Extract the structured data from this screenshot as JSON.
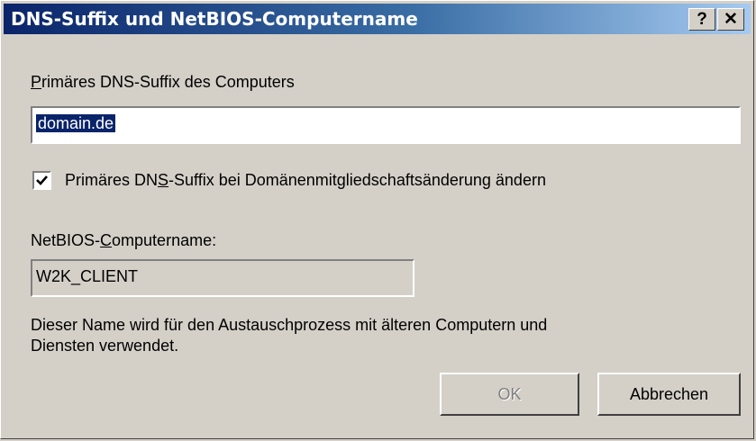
{
  "window": {
    "title": "DNS-Suffix und NetBIOS-Computername",
    "help_button": "?",
    "close_button": "✕"
  },
  "dns_suffix": {
    "label_prefix": "",
    "label_mnemonic": "P",
    "label_rest": "rimäres DNS-Suffix des Computers",
    "value": "domain.de"
  },
  "checkbox": {
    "checked": true,
    "label_prefix": "Primäres DN",
    "label_mnemonic": "S",
    "label_rest": "-Suffix bei Domänenmitgliedschaftsänderung ändern"
  },
  "netbios": {
    "label_prefix": "NetBIOS-",
    "label_mnemonic": "C",
    "label_rest": "omputername:",
    "value": "W2K_CLIENT"
  },
  "info": {
    "line1": "Dieser Name wird für den Austauschprozess mit älteren Computern und",
    "line2": "Diensten verwendet."
  },
  "buttons": {
    "ok": "OK",
    "cancel": "Abbrechen"
  }
}
